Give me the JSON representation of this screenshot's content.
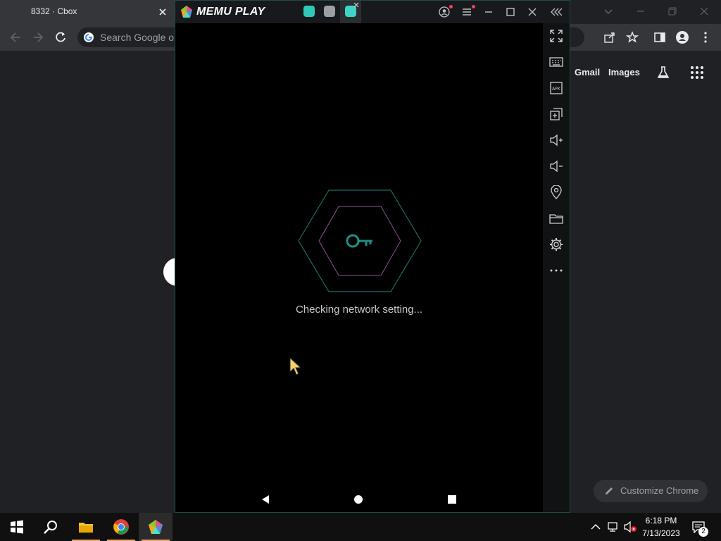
{
  "chrome": {
    "tab_title": "8332 · Cbox",
    "omnibox_placeholder": "Search Google or type a URL",
    "ntp_links": {
      "gmail": "Gmail",
      "images": "Images"
    },
    "customize_label": "Customize Chrome"
  },
  "memu": {
    "brand": "MEMU PLAY",
    "sidebar_icons": [
      "fullscreen-icon",
      "keyboard-icon",
      "apk-icon",
      "multi-instance-icon",
      "volume-up-icon",
      "volume-down-icon",
      "location-icon",
      "folder-icon",
      "settings-icon",
      "more-icon"
    ],
    "status_text": "Checking network setting...",
    "accent_color": "#2fc9b9"
  },
  "taskbar": {
    "time": "6:18 PM",
    "date": "7/13/2023",
    "notification_count": "2"
  }
}
